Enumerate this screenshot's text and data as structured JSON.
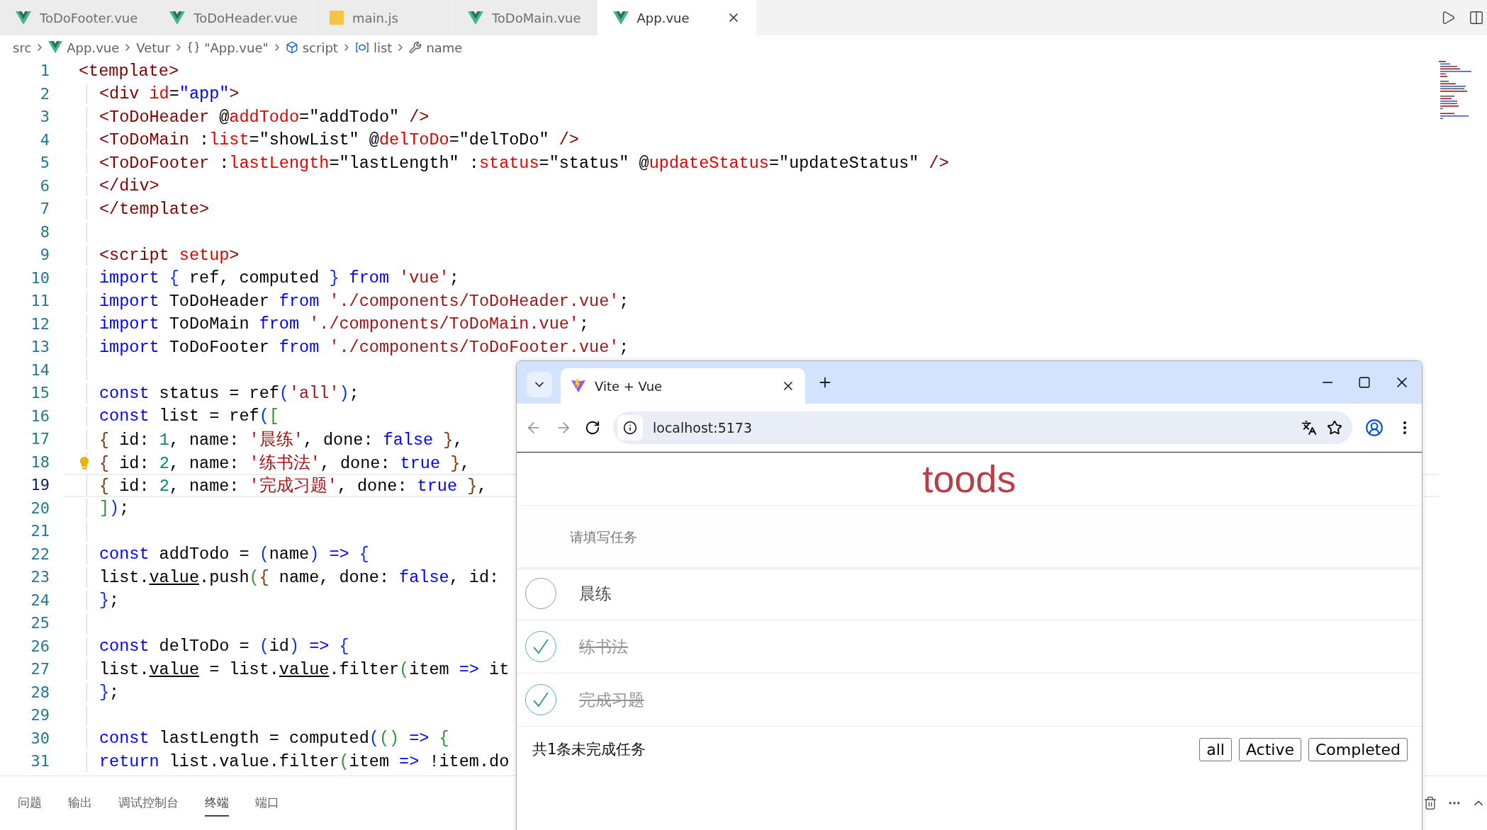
{
  "editor_tabs": [
    {
      "label": "ToDoFooter.vue",
      "kind": "vue",
      "selected": false
    },
    {
      "label": "ToDoHeader.vue",
      "kind": "vue",
      "selected": false
    },
    {
      "label": "main.js",
      "kind": "js",
      "selected": false
    },
    {
      "label": "ToDoMain.vue",
      "kind": "vue",
      "selected": false
    },
    {
      "label": "App.vue",
      "kind": "vue",
      "selected": true
    }
  ],
  "breadcrumb": [
    {
      "label": "src",
      "kind": "plain"
    },
    {
      "label": "App.vue",
      "kind": "vue"
    },
    {
      "label": "Vetur",
      "kind": "plain"
    },
    {
      "label": "\"App.vue\"",
      "kind": "braces"
    },
    {
      "label": "script",
      "kind": "box"
    },
    {
      "label": "list",
      "kind": "variable"
    },
    {
      "label": "name",
      "kind": "wrench"
    }
  ],
  "code_lines": [
    {
      "number": "1",
      "indented": false,
      "current": false,
      "lightbulb": false,
      "tokens": [
        {
          "kind": "tag",
          "text": "<template>"
        }
      ]
    },
    {
      "number": "2",
      "indented": true,
      "current": false,
      "lightbulb": false,
      "tokens": [
        {
          "kind": "tag",
          "text": "<div "
        },
        {
          "kind": "attr",
          "text": "id"
        },
        {
          "kind": "p",
          "text": "="
        },
        {
          "kind": "val",
          "text": "\"app\""
        },
        {
          "kind": "tag",
          "text": ">"
        }
      ]
    },
    {
      "number": "3",
      "indented": true,
      "current": false,
      "lightbulb": false,
      "tokens": [
        {
          "kind": "tag",
          "text": "<ToDoHeader "
        },
        {
          "kind": "p",
          "text": "@"
        },
        {
          "kind": "attr",
          "text": "addTodo"
        },
        {
          "kind": "p",
          "text": "=\"addTodo\" "
        },
        {
          "kind": "tag",
          "text": "/>"
        }
      ]
    },
    {
      "number": "4",
      "indented": true,
      "current": false,
      "lightbulb": false,
      "tokens": [
        {
          "kind": "tag",
          "text": "<ToDoMain "
        },
        {
          "kind": "p",
          "text": ":"
        },
        {
          "kind": "attr",
          "text": "list"
        },
        {
          "kind": "p",
          "text": "=\"showList\" @"
        },
        {
          "kind": "attr",
          "text": "delToDo"
        },
        {
          "kind": "p",
          "text": "=\"delToDo\" "
        },
        {
          "kind": "tag",
          "text": "/>"
        }
      ]
    },
    {
      "number": "5",
      "indented": true,
      "current": false,
      "lightbulb": false,
      "tokens": [
        {
          "kind": "tag",
          "text": "<ToDoFooter "
        },
        {
          "kind": "p",
          "text": ":"
        },
        {
          "kind": "attr",
          "text": "lastLength"
        },
        {
          "kind": "p",
          "text": "=\"lastLength\" :"
        },
        {
          "kind": "attr",
          "text": "status"
        },
        {
          "kind": "p",
          "text": "=\"status\" @"
        },
        {
          "kind": "attr",
          "text": "updateStatus"
        },
        {
          "kind": "p",
          "text": "=\"updateStatus\" "
        },
        {
          "kind": "tag",
          "text": "/>"
        }
      ]
    },
    {
      "number": "6",
      "indented": true,
      "current": false,
      "lightbulb": false,
      "tokens": [
        {
          "kind": "tag",
          "text": "</div>"
        }
      ]
    },
    {
      "number": "7",
      "indented": true,
      "current": false,
      "lightbulb": false,
      "tokens": [
        {
          "kind": "tag",
          "text": "</template>"
        }
      ]
    },
    {
      "number": "8",
      "indented": true,
      "current": false,
      "lightbulb": false
    },
    {
      "number": "9",
      "indented": true,
      "current": false,
      "lightbulb": false,
      "tokens": [
        {
          "kind": "tag",
          "text": "<script "
        },
        {
          "kind": "attr",
          "text": "setup"
        },
        {
          "kind": "tag",
          "text": ">"
        }
      ]
    },
    {
      "number": "10",
      "indented": true,
      "current": false,
      "lightbulb": false,
      "tokens": [
        {
          "kind": "kw",
          "text": "import "
        },
        {
          "kind": "b1",
          "text": "{"
        },
        {
          "kind": "p",
          "text": " ref, computed "
        },
        {
          "kind": "b1",
          "text": "}"
        },
        {
          "kind": "kw",
          "text": " from "
        },
        {
          "kind": "str",
          "text": "'vue'"
        },
        {
          "kind": "p",
          "text": ";"
        }
      ]
    },
    {
      "number": "11",
      "indented": true,
      "current": false,
      "lightbulb": false,
      "tokens": [
        {
          "kind": "kw",
          "text": "import"
        },
        {
          "kind": "p",
          "text": " ToDoHeader "
        },
        {
          "kind": "kw",
          "text": "from "
        },
        {
          "kind": "str",
          "text": "'./components/ToDoHeader.vue'"
        },
        {
          "kind": "p",
          "text": ";"
        }
      ]
    },
    {
      "number": "12",
      "indented": true,
      "current": false,
      "lightbulb": false,
      "tokens": [
        {
          "kind": "kw",
          "text": "import"
        },
        {
          "kind": "p",
          "text": " ToDoMain "
        },
        {
          "kind": "kw",
          "text": "from "
        },
        {
          "kind": "str",
          "text": "'./components/ToDoMain.vue'"
        },
        {
          "kind": "p",
          "text": ";"
        }
      ]
    },
    {
      "number": "13",
      "indented": true,
      "current": false,
      "lightbulb": false,
      "tokens": [
        {
          "kind": "kw",
          "text": "import"
        },
        {
          "kind": "p",
          "text": " ToDoFooter "
        },
        {
          "kind": "kw",
          "text": "from "
        },
        {
          "kind": "str",
          "text": "'./components/ToDoFooter.vue'"
        },
        {
          "kind": "p",
          "text": ";"
        }
      ]
    },
    {
      "number": "14",
      "indented": true,
      "current": false,
      "lightbulb": false
    },
    {
      "number": "15",
      "indented": true,
      "current": false,
      "lightbulb": false,
      "tokens": [
        {
          "kind": "kw",
          "text": "const"
        },
        {
          "kind": "p",
          "text": " status = ref"
        },
        {
          "kind": "b1",
          "text": "("
        },
        {
          "kind": "str",
          "text": "'all'"
        },
        {
          "kind": "b1",
          "text": ")"
        },
        {
          "kind": "p",
          "text": ";"
        }
      ]
    },
    {
      "number": "16",
      "indented": true,
      "current": false,
      "lightbulb": false,
      "tokens": [
        {
          "kind": "kw",
          "text": "const"
        },
        {
          "kind": "p",
          "text": " list = ref"
        },
        {
          "kind": "b1",
          "text": "("
        },
        {
          "kind": "b2",
          "text": "["
        }
      ]
    },
    {
      "number": "17",
      "indented": true,
      "current": false,
      "lightbulb": false,
      "tokens": [
        {
          "kind": "b3",
          "text": "{"
        },
        {
          "kind": "p",
          "text": " id: "
        },
        {
          "kind": "num",
          "text": "1"
        },
        {
          "kind": "p",
          "text": ", name: "
        },
        {
          "kind": "str",
          "text": "'晨练'"
        },
        {
          "kind": "p",
          "text": ", done: "
        },
        {
          "kind": "kw",
          "text": "false"
        },
        {
          "kind": "b3",
          "text": " }"
        },
        {
          "kind": "p",
          "text": ","
        }
      ]
    },
    {
      "number": "18",
      "indented": true,
      "current": false,
      "lightbulb": true,
      "tokens": [
        {
          "kind": "b3",
          "text": "{"
        },
        {
          "kind": "p",
          "text": " id: "
        },
        {
          "kind": "num",
          "text": "2"
        },
        {
          "kind": "p",
          "text": ", name: "
        },
        {
          "kind": "str",
          "text": "'练书法'"
        },
        {
          "kind": "p",
          "text": ", done: "
        },
        {
          "kind": "kw",
          "text": "true"
        },
        {
          "kind": "b3",
          "text": " }"
        },
        {
          "kind": "p",
          "text": ","
        }
      ]
    },
    {
      "number": "19",
      "indented": true,
      "current": true,
      "lightbulb": false,
      "tokens": [
        {
          "kind": "b3",
          "text": "{"
        },
        {
          "kind": "p",
          "text": " id: "
        },
        {
          "kind": "num",
          "text": "2"
        },
        {
          "kind": "p",
          "text": ", name: "
        },
        {
          "kind": "str",
          "text": "'完成习题'"
        },
        {
          "kind": "p",
          "text": ", done: "
        },
        {
          "kind": "kw",
          "text": "true"
        },
        {
          "kind": "b3",
          "text": " }"
        },
        {
          "kind": "p",
          "text": ","
        }
      ]
    },
    {
      "number": "20",
      "indented": true,
      "current": false,
      "lightbulb": false,
      "tokens": [
        {
          "kind": "b2",
          "text": "]"
        },
        {
          "kind": "b1",
          "text": ")"
        },
        {
          "kind": "p",
          "text": ";"
        }
      ]
    },
    {
      "number": "21",
      "indented": true,
      "current": false,
      "lightbulb": false
    },
    {
      "number": "22",
      "indented": true,
      "current": false,
      "lightbulb": false,
      "tokens": [
        {
          "kind": "kw",
          "text": "const"
        },
        {
          "kind": "p",
          "text": " addTodo = "
        },
        {
          "kind": "b1",
          "text": "("
        },
        {
          "kind": "p",
          "text": "name"
        },
        {
          "kind": "b1",
          "text": ")"
        },
        {
          "kind": "kw",
          "text": " => "
        },
        {
          "kind": "b1",
          "text": "{"
        }
      ]
    },
    {
      "number": "23",
      "indented": true,
      "current": false,
      "lightbulb": false,
      "tokens": [
        {
          "kind": "p",
          "text": "list."
        },
        {
          "kind": "u",
          "text": "value"
        },
        {
          "kind": "p",
          "text": ".push"
        },
        {
          "kind": "b2",
          "text": "("
        },
        {
          "kind": "b3",
          "text": "{"
        },
        {
          "kind": "p",
          "text": " name, done: "
        },
        {
          "kind": "kw",
          "text": "false"
        },
        {
          "kind": "p",
          "text": ", id:"
        }
      ]
    },
    {
      "number": "24",
      "indented": true,
      "current": false,
      "lightbulb": false,
      "tokens": [
        {
          "kind": "b1",
          "text": "}"
        },
        {
          "kind": "p",
          "text": ";"
        }
      ]
    },
    {
      "number": "25",
      "indented": true,
      "current": false,
      "lightbulb": false
    },
    {
      "number": "26",
      "indented": true,
      "current": false,
      "lightbulb": false,
      "tokens": [
        {
          "kind": "kw",
          "text": "const"
        },
        {
          "kind": "p",
          "text": " delToDo = "
        },
        {
          "kind": "b1",
          "text": "("
        },
        {
          "kind": "p",
          "text": "id"
        },
        {
          "kind": "b1",
          "text": ")"
        },
        {
          "kind": "kw",
          "text": " => "
        },
        {
          "kind": "b1",
          "text": "{"
        }
      ]
    },
    {
      "number": "27",
      "indented": true,
      "current": false,
      "lightbulb": false,
      "tokens": [
        {
          "kind": "p",
          "text": "list."
        },
        {
          "kind": "u",
          "text": "value"
        },
        {
          "kind": "p",
          "text": " = list."
        },
        {
          "kind": "u",
          "text": "value"
        },
        {
          "kind": "p",
          "text": ".filter"
        },
        {
          "kind": "b2",
          "text": "("
        },
        {
          "kind": "p",
          "text": "item "
        },
        {
          "kind": "kw",
          "text": "=>"
        },
        {
          "kind": "p",
          "text": " it"
        }
      ]
    },
    {
      "number": "28",
      "indented": true,
      "current": false,
      "lightbulb": false,
      "tokens": [
        {
          "kind": "b1",
          "text": "}"
        },
        {
          "kind": "p",
          "text": ";"
        }
      ]
    },
    {
      "number": "29",
      "indented": true,
      "current": false,
      "lightbulb": false
    },
    {
      "number": "30",
      "indented": true,
      "current": false,
      "lightbulb": false,
      "tokens": [
        {
          "kind": "kw",
          "text": "const"
        },
        {
          "kind": "p",
          "text": " lastLength = computed"
        },
        {
          "kind": "b1",
          "text": "("
        },
        {
          "kind": "b2",
          "text": "()"
        },
        {
          "kind": "kw",
          "text": " => "
        },
        {
          "kind": "b2",
          "text": "{"
        }
      ]
    },
    {
      "number": "31",
      "indented": true,
      "current": false,
      "lightbulb": false,
      "tokens": [
        {
          "kind": "kw",
          "text": "return"
        },
        {
          "kind": "p",
          "text": " list.value.filter"
        },
        {
          "kind": "b2",
          "text": "("
        },
        {
          "kind": "p",
          "text": "item "
        },
        {
          "kind": "kw",
          "text": "=>"
        },
        {
          "kind": "p",
          "text": " !item.do"
        }
      ]
    }
  ],
  "panel_tabs": [
    {
      "label": "问题",
      "selected": false
    },
    {
      "label": "输出",
      "selected": false
    },
    {
      "label": "调试控制台",
      "selected": false
    },
    {
      "label": "终端",
      "selected": true
    },
    {
      "label": "端口",
      "selected": false
    }
  ],
  "browser": {
    "tab_title": "Vite + Vue",
    "url": "localhost:5173"
  },
  "app": {
    "title": "toods",
    "placeholder": "请填写任务",
    "todos": [
      {
        "name": "晨练",
        "done": false
      },
      {
        "name": "练书法",
        "done": true
      },
      {
        "name": "完成习题",
        "done": true
      }
    ],
    "footer_text": "共1条未完成任务",
    "filters": [
      "all",
      "Active",
      "Completed"
    ]
  }
}
